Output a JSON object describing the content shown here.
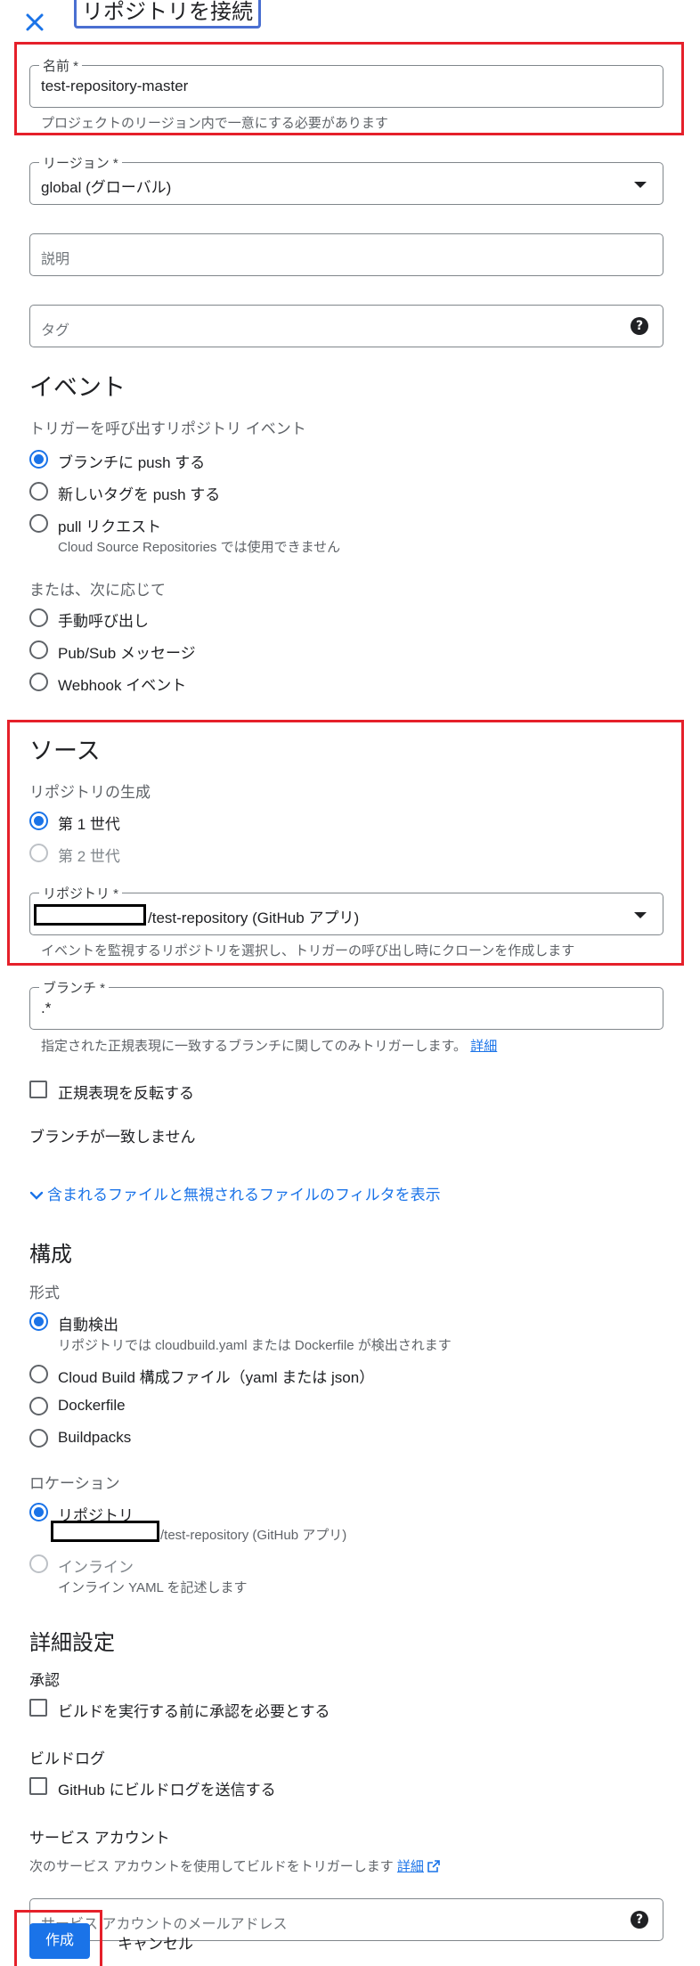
{
  "header": {
    "title": "リポジトリを接続"
  },
  "name_field": {
    "label": "名前 *",
    "value": "test-repository-master",
    "hint": "プロジェクトのリージョン内で一意にする必要があります"
  },
  "region_field": {
    "label": "リージョン *",
    "value": "global (グローバル)"
  },
  "description_field": {
    "placeholder": "説明"
  },
  "tags_field": {
    "placeholder": "タグ"
  },
  "event": {
    "heading": "イベント",
    "subheading": "トリガーを呼び出すリポジトリ イベント",
    "options": [
      {
        "label": "ブランチに push する",
        "selected": true
      },
      {
        "label": "新しいタグを push する",
        "selected": false
      },
      {
        "label": "pull リクエスト",
        "selected": false,
        "note": "Cloud Source Repositories では使用できません"
      }
    ],
    "alt_subheading": "または、次に応じて",
    "alt_options": [
      {
        "label": "手動呼び出し",
        "selected": false
      },
      {
        "label": "Pub/Sub メッセージ",
        "selected": false
      },
      {
        "label": "Webhook イベント",
        "selected": false
      }
    ]
  },
  "source": {
    "heading": "ソース",
    "subheading": "リポジトリの生成",
    "options": [
      {
        "label": "第 1 世代",
        "selected": true
      },
      {
        "label": "第 2 世代",
        "selected": false,
        "disabled": true
      }
    ],
    "repository_field": {
      "label": "リポジトリ *",
      "value": "/test-repository (GitHub アプリ)",
      "hint": "イベントを監視するリポジトリを選択し、トリガーの呼び出し時にクローンを作成します"
    }
  },
  "branch_field": {
    "label": "ブランチ *",
    "value": ".*",
    "hint": "指定された正規表現に一致するブランチに関してのみトリガーします。",
    "hint_link": "詳細"
  },
  "invert_regex": {
    "label": "正規表現を反転する",
    "checked": false
  },
  "branch_status": "ブランチが一致しません",
  "filter_toggle": {
    "label": "含まれるファイルと無視されるファイルのフィルタを表示"
  },
  "config": {
    "heading": "構成",
    "type_label": "形式",
    "type_options": [
      {
        "label": "自動検出",
        "selected": true,
        "note": "リポジトリでは cloudbuild.yaml または Dockerfile が検出されます"
      },
      {
        "label": "Cloud Build 構成ファイル（yaml または json）",
        "selected": false
      },
      {
        "label": "Dockerfile",
        "selected": false
      },
      {
        "label": "Buildpacks",
        "selected": false
      }
    ],
    "location_label": "ロケーション",
    "location_options": [
      {
        "label": "リポジトリ",
        "selected": true,
        "note": "/test-repository (GitHub アプリ)"
      },
      {
        "label": "インライン",
        "selected": false,
        "disabled": true,
        "note": "インライン YAML を記述します"
      }
    ]
  },
  "advanced": {
    "heading": "詳細設定",
    "approval_label": "承認",
    "approval_checkbox": "ビルドを実行する前に承認を必要とする",
    "build_log_label": "ビルドログ",
    "build_log_checkbox": "GitHub にビルドログを送信する",
    "service_account_label": "サービス アカウント",
    "service_account_hint": "次のサービス アカウントを使用してビルドをトリガーします",
    "service_account_link": "詳細",
    "service_account_field": {
      "placeholder": "サービス アカウントのメールアドレス"
    }
  },
  "actions": {
    "create_label": "作成",
    "cancel_label": "キャンセル"
  },
  "colors": {
    "accent": "#1a73e8",
    "highlight": "#e5202a"
  }
}
